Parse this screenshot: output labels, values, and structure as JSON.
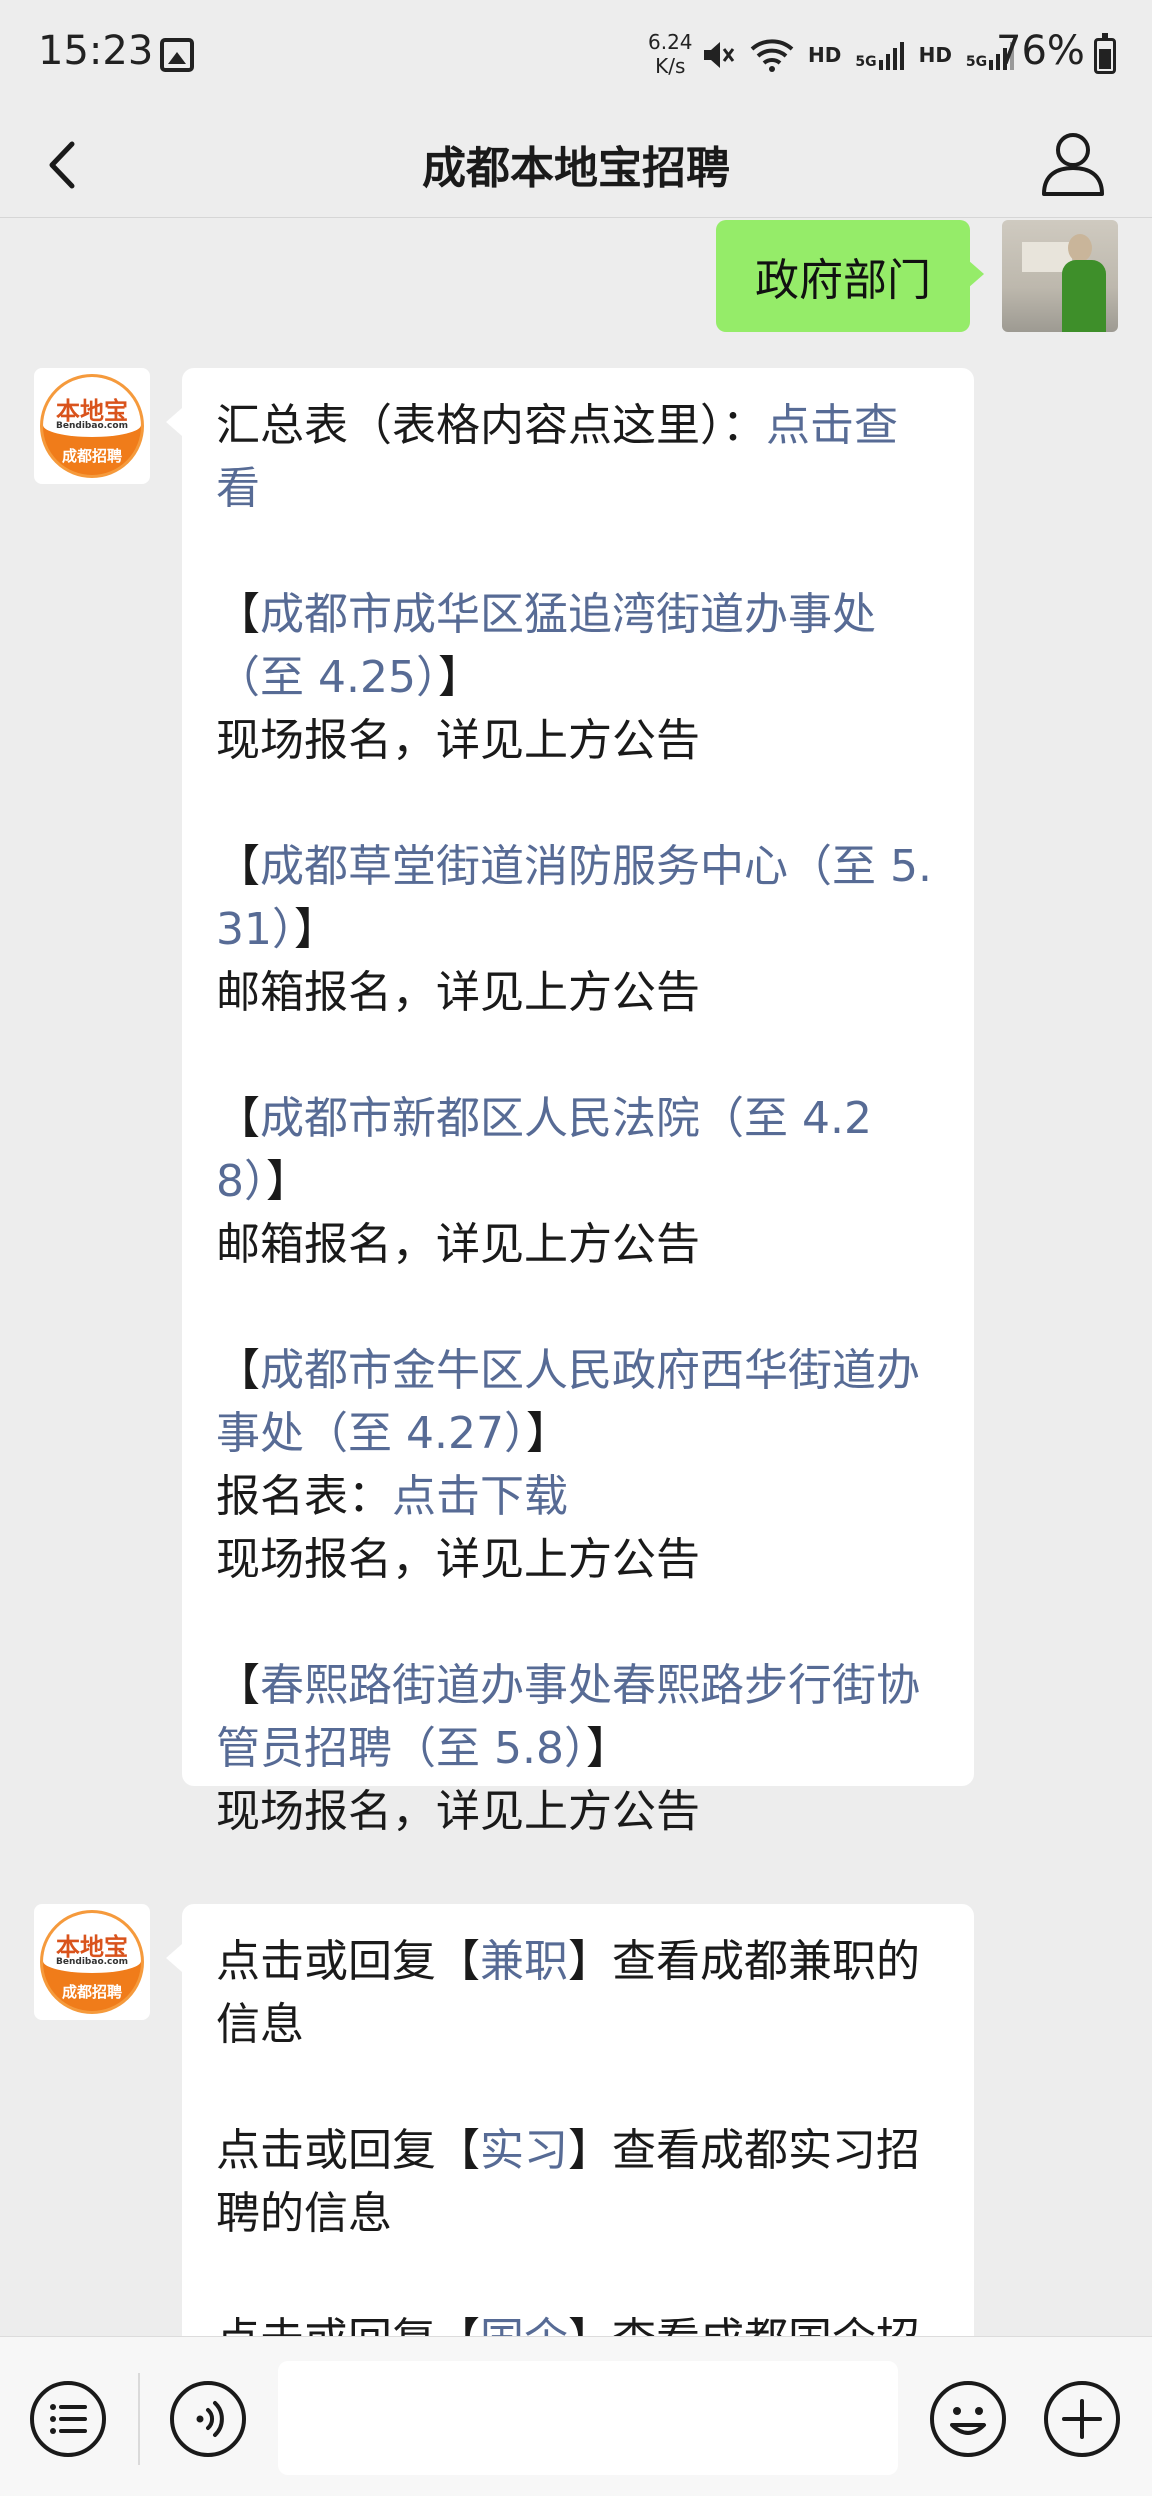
{
  "status_bar": {
    "time": "15:23",
    "net_speed_value": "6.24",
    "net_speed_unit": "K/s",
    "hd1": "HD",
    "sig1": "5G",
    "hd2": "HD",
    "sig2": "5G",
    "battery": "76%",
    "icons": [
      "photo-icon",
      "mute-icon",
      "wifi-icon",
      "signal-icon",
      "signal-icon",
      "battery-icon"
    ]
  },
  "header": {
    "title": "成都本地宝招聘",
    "back_icon": "chevron-left-icon",
    "profile_icon": "person-icon"
  },
  "my_message": {
    "text": "政府部门"
  },
  "bot_logo": {
    "main": "本地宝",
    "sub": "Bendibao.com",
    "bottom": "成都招聘"
  },
  "bot_message_1": {
    "summary_prefix": "汇总表（表格内容点这里）：",
    "summary_link": "点击查看",
    "items": [
      {
        "open": "【",
        "link": "成都市成华区猛追湾街道办事处（至 4.25）",
        "close": "】",
        "notes": [
          "现场报名，详见上方公告"
        ]
      },
      {
        "open": "【",
        "link": "成都草堂街道消防服务中心（至 5.31）",
        "close": "】",
        "notes": [
          "邮箱报名，详见上方公告"
        ]
      },
      {
        "open": "【",
        "link": "成都市新都区人民法院（至 4.28）",
        "close": "】",
        "notes": [
          "邮箱报名，详见上方公告"
        ]
      },
      {
        "open": "【",
        "link": "成都市金牛区人民政府西华街道办事处（至 4.27）",
        "close": "】",
        "form_prefix": "报名表：",
        "form_link": "点击下载",
        "notes": [
          "现场报名，详见上方公告"
        ]
      },
      {
        "open": "【",
        "link": "春熙路街道办事处春熙路步行街协管员招聘（至 5.8）",
        "close": "】",
        "notes": [
          "现场报名，详见上方公告"
        ]
      }
    ]
  },
  "bot_message_2": {
    "items": [
      {
        "prefix": "点击或回复【",
        "keyword": "兼职",
        "suffix": "】查看成都兼职的信息"
      },
      {
        "prefix": "点击或回复【",
        "keyword": "实习",
        "suffix": "】查看成都实习招聘的信息"
      },
      {
        "prefix": "点击或回复【",
        "keyword": "国企",
        "suffix": "】查看成都国企招"
      }
    ]
  },
  "input_bar": {
    "placeholder": "",
    "menu_icon": "list-menu-icon",
    "voice_icon": "voice-icon",
    "emoji_icon": "emoji-icon",
    "plus_icon": "plus-icon"
  }
}
